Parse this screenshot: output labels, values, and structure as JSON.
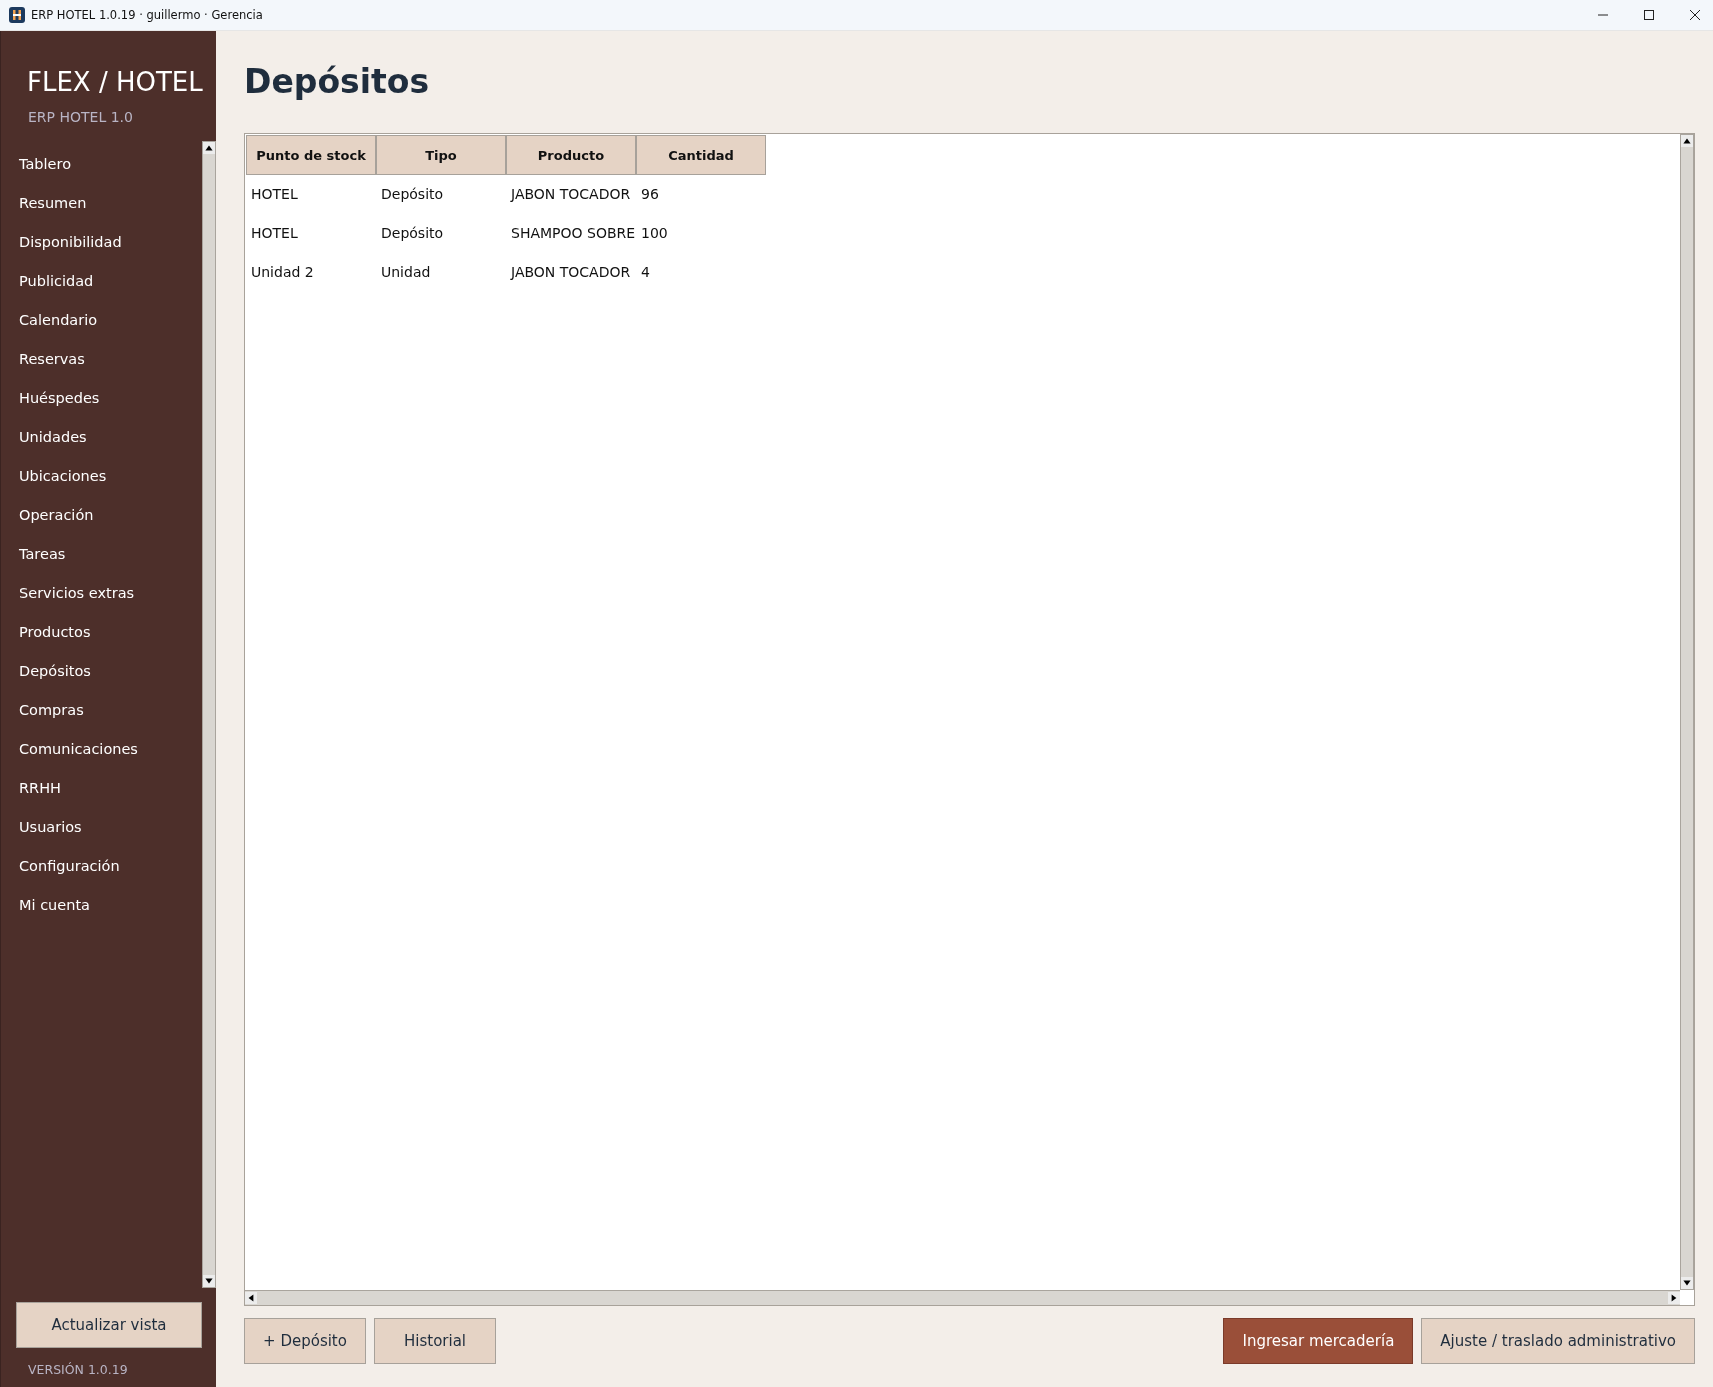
{
  "window": {
    "title": "ERP HOTEL 1.0.19 · guillermo · Gerencia"
  },
  "sidebar": {
    "brand": "FLEX / HOTEL",
    "subtitle": "ERP HOTEL 1.0",
    "items": [
      {
        "label": "Tablero"
      },
      {
        "label": "Resumen"
      },
      {
        "label": "Disponibilidad"
      },
      {
        "label": "Publicidad"
      },
      {
        "label": "Calendario"
      },
      {
        "label": "Reservas"
      },
      {
        "label": "Huéspedes"
      },
      {
        "label": "Unidades"
      },
      {
        "label": "Ubicaciones"
      },
      {
        "label": "Operación"
      },
      {
        "label": "Tareas"
      },
      {
        "label": "Servicios extras"
      },
      {
        "label": "Productos"
      },
      {
        "label": "Depósitos"
      },
      {
        "label": "Compras"
      },
      {
        "label": "Comunicaciones"
      },
      {
        "label": "RRHH"
      },
      {
        "label": "Usuarios"
      },
      {
        "label": "Configuración"
      },
      {
        "label": "Mi cuenta"
      }
    ],
    "refresh_button": "Actualizar vista",
    "version": "VERSIÓN 1.0.19"
  },
  "page": {
    "title": "Depósitos"
  },
  "table": {
    "columns": [
      "Punto de stock",
      "Tipo",
      "Producto",
      "Cantidad"
    ],
    "rows": [
      [
        "HOTEL",
        "Depósito",
        "JABON TOCADOR",
        "96"
      ],
      [
        "HOTEL",
        "Depósito",
        "SHAMPOO SOBRE",
        "100"
      ],
      [
        "Unidad 2",
        "Unidad",
        "JABON TOCADOR",
        "4"
      ]
    ]
  },
  "left_buttons": [
    {
      "label": "+ Depósito",
      "kind": "normal"
    },
    {
      "label": "Historial",
      "kind": "normal"
    }
  ],
  "right_buttons": [
    {
      "label": "Ingresar mercadería",
      "kind": "primary"
    },
    {
      "label": "Ajuste / traslado administrativo",
      "kind": "normal"
    }
  ]
}
